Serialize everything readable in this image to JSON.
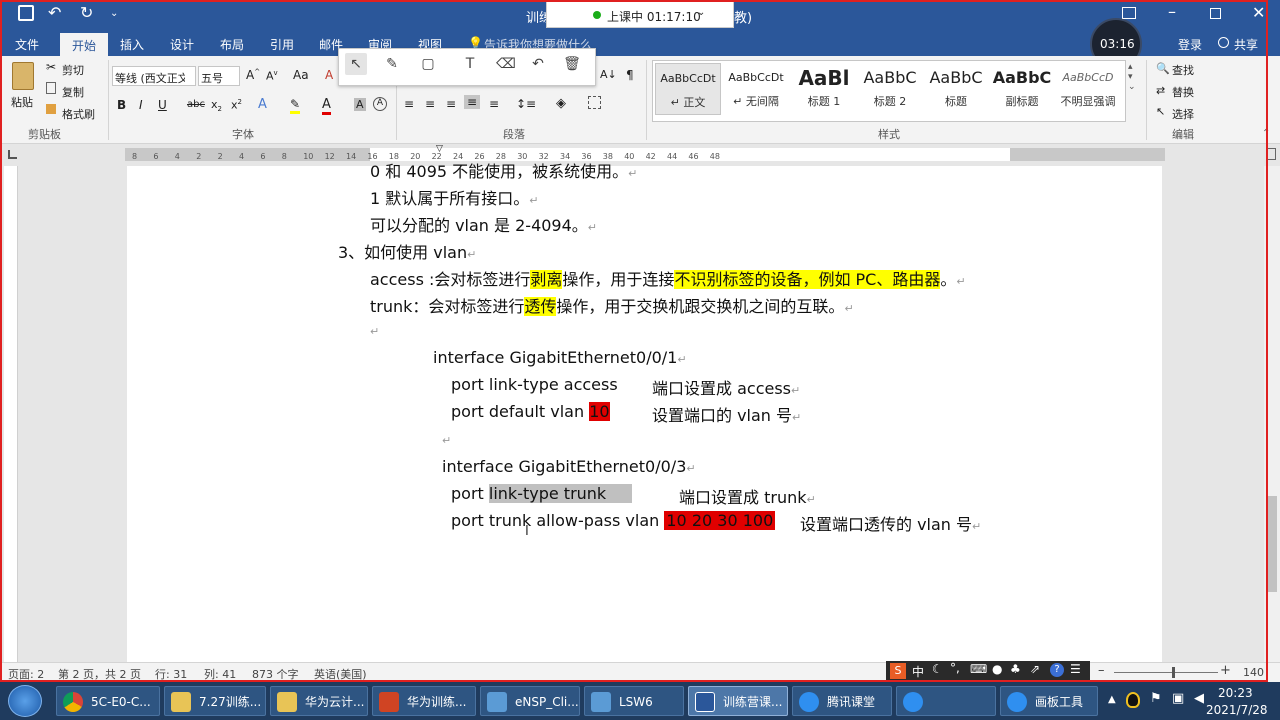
{
  "titlebar": {
    "doc_title": "训练",
    "doc_title_suffix": "教)",
    "class_status": "上课中 01:17:10",
    "login": "登录",
    "share": "共享",
    "timer": "03:16"
  },
  "tabs": [
    "文件",
    "开始",
    "插入",
    "设计",
    "布局",
    "引用",
    "邮件",
    "审阅",
    "视图"
  ],
  "tell_me": "告诉我你想要做什么",
  "clipboard": {
    "paste": "粘贴",
    "cut": "剪切",
    "copy": "复制",
    "format_painter": "格式刷",
    "label": "剪贴板"
  },
  "font": {
    "name": "等线 (西文正文)",
    "size": "五号",
    "label": "字体"
  },
  "paragraph": {
    "label": "段落"
  },
  "styles": {
    "label": "样式",
    "items": [
      {
        "sample": "AaBbCcDt",
        "name": "↵ 正文"
      },
      {
        "sample": "AaBbCcDt",
        "name": "↵ 无间隔"
      },
      {
        "sample": "AaBl",
        "name": "标题 1"
      },
      {
        "sample": "AaBbC",
        "name": "标题 2"
      },
      {
        "sample": "AaBbC",
        "name": "标题"
      },
      {
        "sample": "AaBbC",
        "name": "副标题"
      },
      {
        "sample": "AaBbCcD",
        "name": "不明显强调"
      }
    ]
  },
  "editing": {
    "find": "查找",
    "replace": "替换",
    "select": "选择",
    "label": "编辑"
  },
  "ruler_numbers": [
    "8",
    "6",
    "4",
    "2",
    "2",
    "4",
    "6",
    "8",
    "10",
    "12",
    "14",
    "16",
    "18",
    "20",
    "22",
    "24",
    "26",
    "28",
    "30",
    "32",
    "34",
    "36",
    "38",
    "40",
    "42",
    "44",
    "46",
    "48"
  ],
  "document": {
    "l1": "0 和 4095 不能使用，被系统使用。",
    "l2": "1 默认属于所有接口。",
    "l3": "可以分配的 vlan 是 2-4094。",
    "l4": "3、如何使用 vlan",
    "l5_a": "access :会对标签进行",
    "l5_b": "剥离",
    "l5_c": "操作，用于连接",
    "l5_d": "不识别标签的设备，例如 PC、路由器",
    "l5_e": "。",
    "l6_a": "trunk：会对标签进行",
    "l6_b": "透传",
    "l6_c": "操作，用于交换机跟交换机之间的互联。",
    "c1": "interface GigabitEthernet0/0/1",
    "c2_a": "port link-type access",
    "c2_b": "端口设置成 access",
    "c3_a": "port default vlan ",
    "c3_b": "10",
    "c3_c": "设置端口的 vlan 号",
    "c4": "interface GigabitEthernet0/0/3",
    "c5_a": "port ",
    "c5_b": "link-type trunk",
    "c5_c": "端口设置成 trunk",
    "c6_a": "port trunk allow-pass vlan ",
    "c6_b": "10 20 30 100",
    "c6_c": "设置端口透传的 vlan 号"
  },
  "status": {
    "page": "页面: 2",
    "pages": "第 2 页，共 2 页",
    "row": "行: 31",
    "col": "列: 41",
    "words": "873 个字",
    "lang": "英语(美国)",
    "zoom": "140"
  },
  "taskbar": {
    "items": [
      "5C-E0-C...",
      "7.27训练...",
      "华为云计...",
      "华为训练...",
      "eNSP_Cli...",
      "LSW6",
      "训练营课...",
      "腾讯课堂",
      "",
      "画板工具"
    ],
    "time": "20:23",
    "date": "2021/7/28"
  },
  "ime": {
    "lang": "中"
  }
}
